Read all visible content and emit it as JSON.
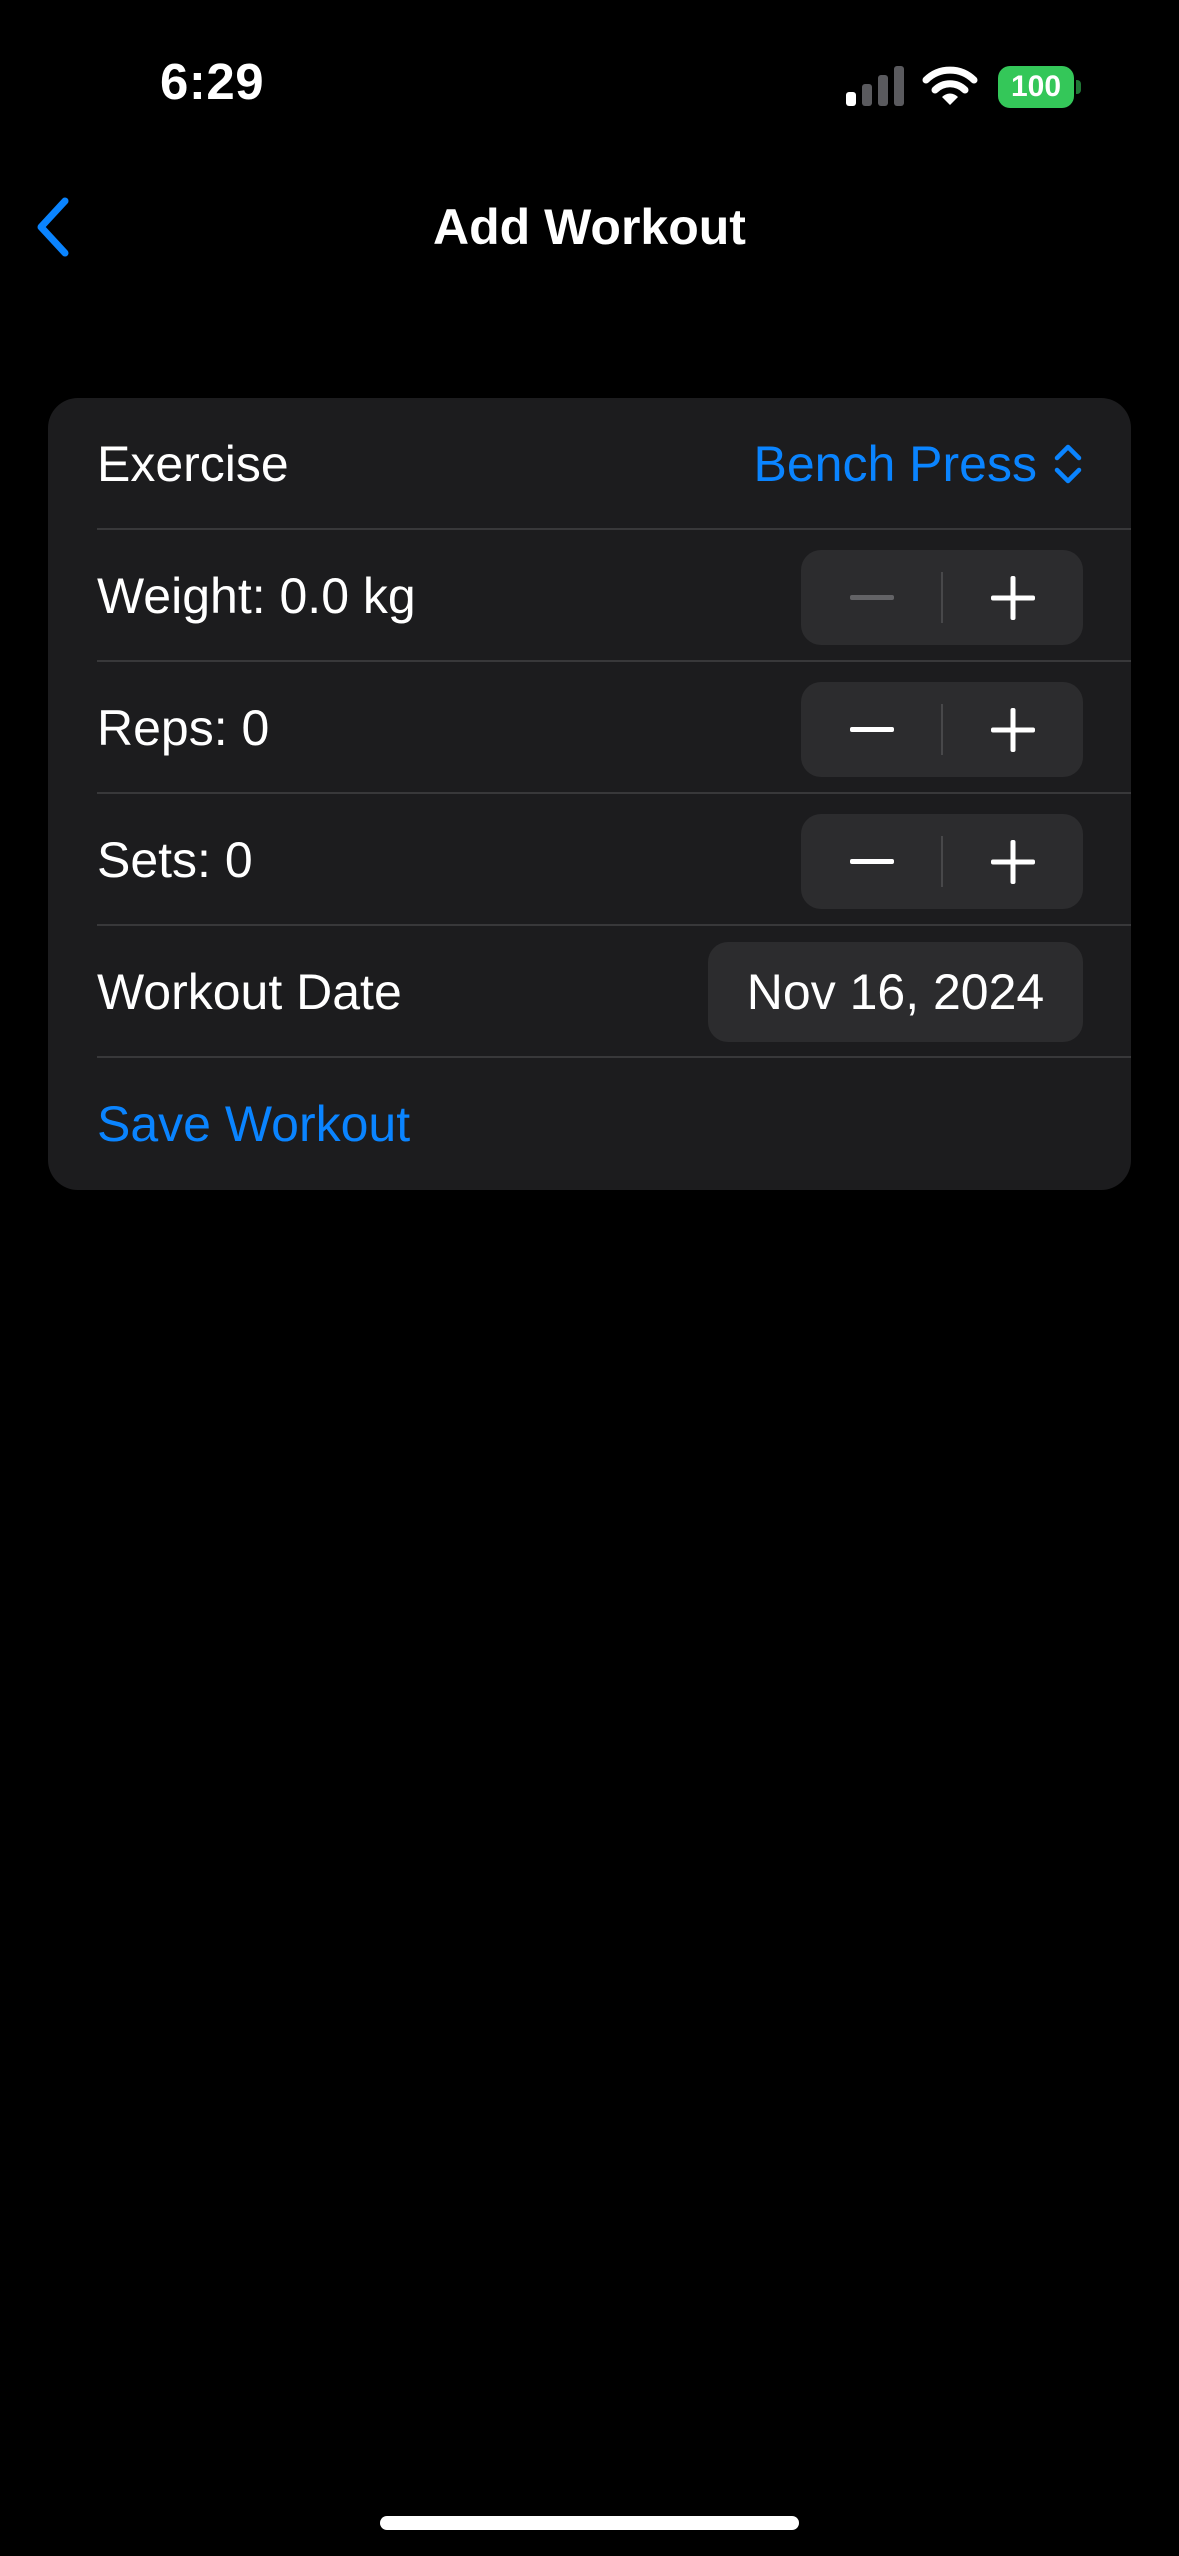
{
  "status_bar": {
    "time": "6:29",
    "battery_level": "100",
    "battery_color": "#34c759",
    "signal_bars_active": 1,
    "signal_bars_total": 4,
    "icons": [
      "signal-icon",
      "wifi-icon",
      "battery-icon"
    ]
  },
  "nav": {
    "title": "Add Workout",
    "back_icon": "chevron-left-icon"
  },
  "form": {
    "exercise": {
      "label": "Exercise",
      "value": "Bench Press",
      "icon": "chevron-up-down-icon"
    },
    "weight": {
      "label": "Weight: 0.0 kg",
      "minus_enabled": false,
      "plus_enabled": true
    },
    "reps": {
      "label": "Reps: 0",
      "minus_enabled": true,
      "plus_enabled": true
    },
    "sets": {
      "label": "Sets: 0",
      "minus_enabled": true,
      "plus_enabled": true
    },
    "date": {
      "label": "Workout Date",
      "value": "Nov 16, 2024"
    },
    "save_label": "Save Workout"
  },
  "colors": {
    "accent": "#0a84ff",
    "background": "#000000",
    "card": "#1c1c1e",
    "control": "#2c2c2e"
  }
}
